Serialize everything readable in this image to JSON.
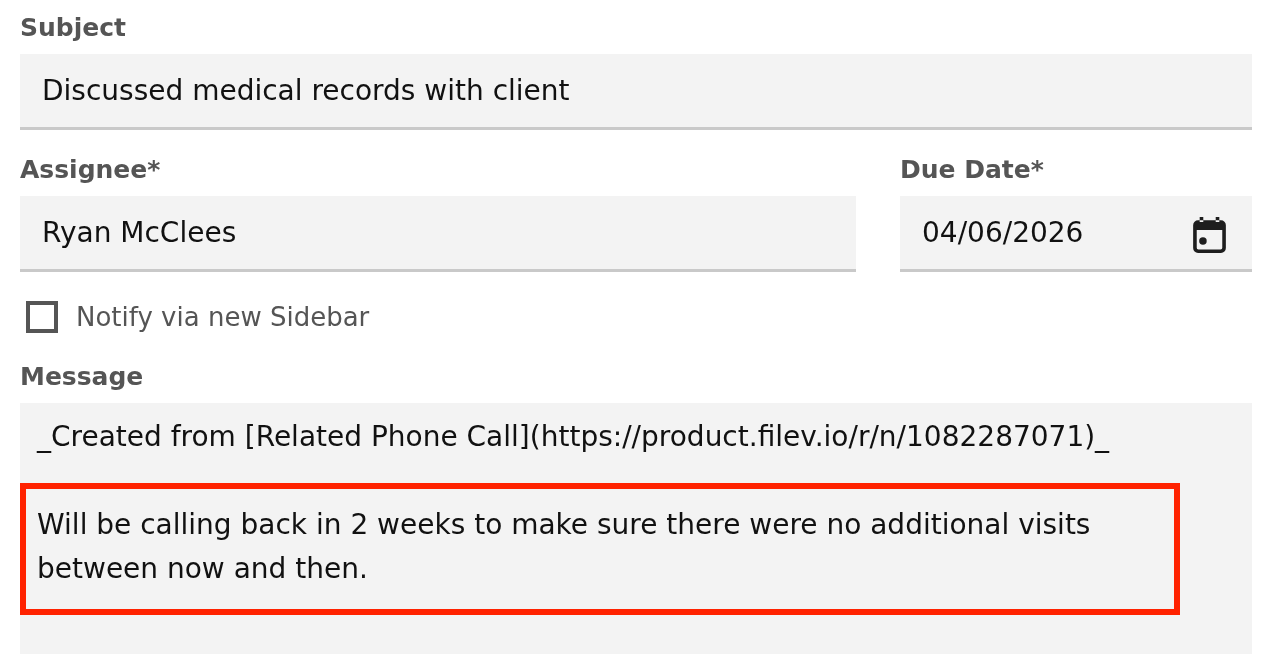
{
  "subject": {
    "label": "Subject",
    "value": "Discussed medical records with client"
  },
  "assignee": {
    "label": "Assignee*",
    "value": "Ryan McClees"
  },
  "due_date": {
    "label": "Due Date*",
    "value": "04/06/2026"
  },
  "notify": {
    "label": "Notify via new Sidebar",
    "checked": false
  },
  "message": {
    "label": "Message",
    "paragraphs": [
      {
        "text": "_Created from [Related Phone Call](https://product.filev.io/r/n/1082287071)_",
        "highlighted": false
      },
      {
        "text": "Will be calling back in 2 weeks to make sure there were no additional visits between now and then.",
        "highlighted": true
      }
    ]
  }
}
